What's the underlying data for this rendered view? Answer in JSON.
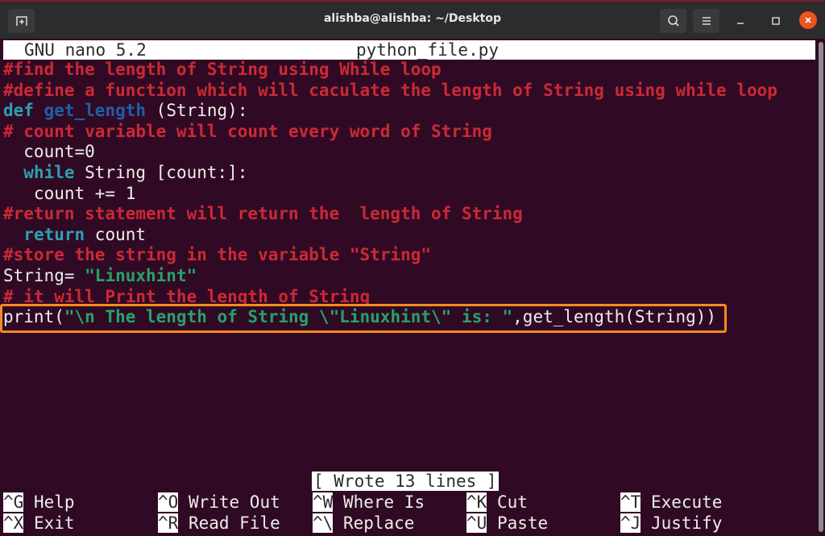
{
  "window": {
    "title": "alishba@alishba: ~/Desktop",
    "icons": {
      "new_tab": "new-tab-icon",
      "search": "search-icon",
      "menu": "hamburger-menu-icon",
      "minimize": "minimize-icon",
      "maximize": "maximize-icon",
      "close": "close-icon"
    }
  },
  "nano": {
    "version": "GNU nano 5.2",
    "filename": "python_file.py",
    "status": "[ Wrote 13 lines ]"
  },
  "code": {
    "lines": [
      [
        {
          "t": "#find the length of String using While loop",
          "c": "cm"
        }
      ],
      [
        {
          "t": "#define a function which will caculate the length of String using while loop",
          "c": "cm"
        }
      ],
      [
        {
          "t": "def",
          "c": "kw"
        },
        {
          "t": " ",
          "c": "tx"
        },
        {
          "t": "get_length",
          "c": "fn"
        },
        {
          "t": " (String):",
          "c": "tx"
        }
      ],
      [
        {
          "t": "# count variable will count every word of String",
          "c": "cm"
        }
      ],
      [
        {
          "t": "  count=0",
          "c": "tx"
        }
      ],
      [
        {
          "t": "  ",
          "c": "tx"
        },
        {
          "t": "while",
          "c": "kw"
        },
        {
          "t": " String [count:]:",
          "c": "tx"
        }
      ],
      [
        {
          "t": "   count += 1",
          "c": "tx"
        }
      ],
      [
        {
          "t": "#return statement will return the  length of String",
          "c": "cm"
        }
      ],
      [
        {
          "t": "  ",
          "c": "tx"
        },
        {
          "t": "return",
          "c": "kw"
        },
        {
          "t": " count",
          "c": "tx"
        }
      ],
      [
        {
          "t": "#store the string in the variable \"String\"",
          "c": "cm"
        }
      ],
      [
        {
          "t": "String= ",
          "c": "tx"
        },
        {
          "t": "\"Linuxhint\"",
          "c": "st"
        }
      ],
      [
        {
          "t": "# it will Print the length of String",
          "c": "cm"
        }
      ],
      [
        {
          "t": "print(",
          "c": "tx"
        },
        {
          "t": "\"\\n The length of String \\\"Linuxhint\\\" is: \"",
          "c": "st"
        },
        {
          "t": ",get_length(String))",
          "c": "tx"
        }
      ]
    ],
    "highlighted_line_index": 12,
    "highlight_color": "#f68b1f"
  },
  "shortcuts": [
    {
      "key": "^G",
      "label": "Help"
    },
    {
      "key": "^O",
      "label": "Write Out"
    },
    {
      "key": "^W",
      "label": "Where Is"
    },
    {
      "key": "^K",
      "label": "Cut"
    },
    {
      "key": "^T",
      "label": "Execute"
    },
    {
      "key": "^X",
      "label": "Exit"
    },
    {
      "key": "^R",
      "label": "Read File"
    },
    {
      "key": "^\\",
      "label": "Replace"
    },
    {
      "key": "^U",
      "label": "Paste"
    },
    {
      "key": "^J",
      "label": "Justify"
    }
  ],
  "colors": {
    "background": "#300a24",
    "comment": "#cc2936",
    "keyword": "#2aa1b3",
    "function": "#1f5fa8",
    "string": "#26a269",
    "close_button": "#e9541f"
  }
}
